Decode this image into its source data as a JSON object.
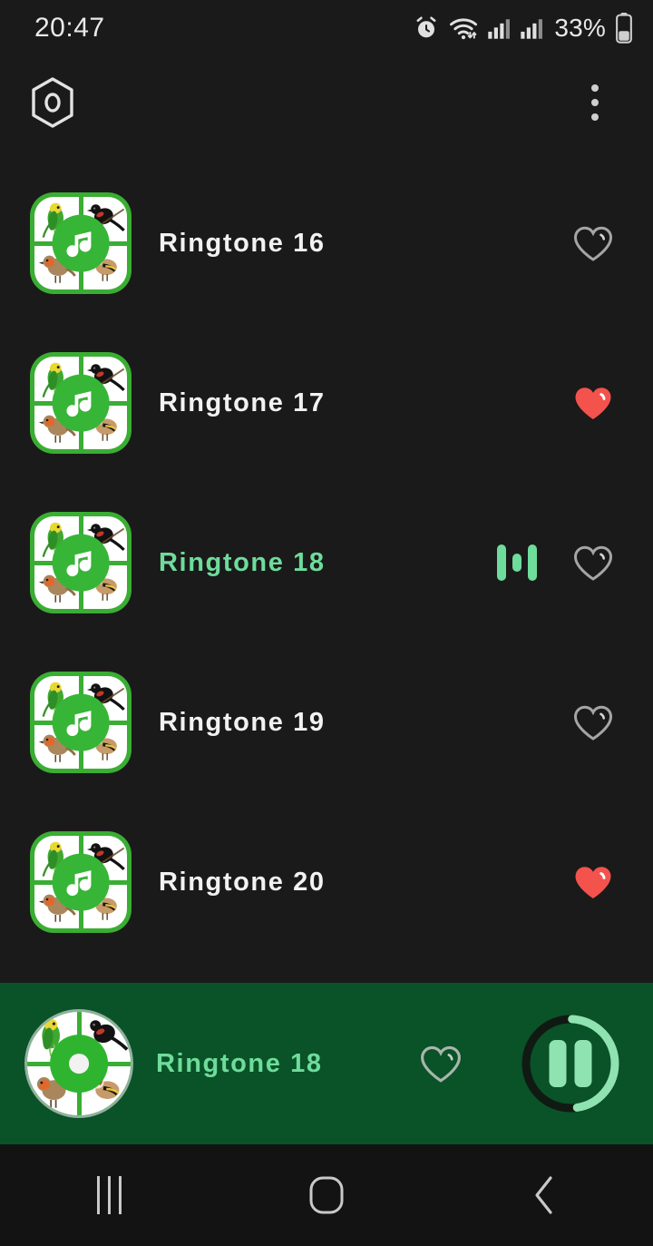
{
  "status_bar": {
    "time": "20:47",
    "battery_percent": "33%",
    "icons": [
      "alarm-icon",
      "wifi-icon",
      "signal-icon",
      "signal-icon",
      "battery-icon"
    ]
  },
  "toolbar": {
    "left_icon": "hexagon-settings-icon",
    "overflow_icon": "more-vertical-icon"
  },
  "colors": {
    "background": "#1a1a1a",
    "player_background": "#0a5227",
    "accent_green": "#6edc9b",
    "icon_green": "#3aad33",
    "favorite_red": "#f4524d",
    "text_primary": "#f2f2f2",
    "nav_background": "#131313"
  },
  "list": {
    "items": [
      {
        "title": "Ringtone 16",
        "favorite": false,
        "playing": false
      },
      {
        "title": "Ringtone 17",
        "favorite": true,
        "playing": false
      },
      {
        "title": "Ringtone 18",
        "favorite": false,
        "playing": true
      },
      {
        "title": "Ringtone 19",
        "favorite": false,
        "playing": false
      },
      {
        "title": "Ringtone 20",
        "favorite": true,
        "playing": false
      }
    ]
  },
  "player": {
    "title": "Ringtone 18",
    "favorite": false,
    "state": "playing",
    "control_icon": "pause-icon",
    "progress_percent": 47,
    "artwork": "bird-ringtone-disc"
  },
  "nav_bar": {
    "recents_label": "recents-icon",
    "home_label": "home-icon",
    "back_label": "back-icon"
  }
}
